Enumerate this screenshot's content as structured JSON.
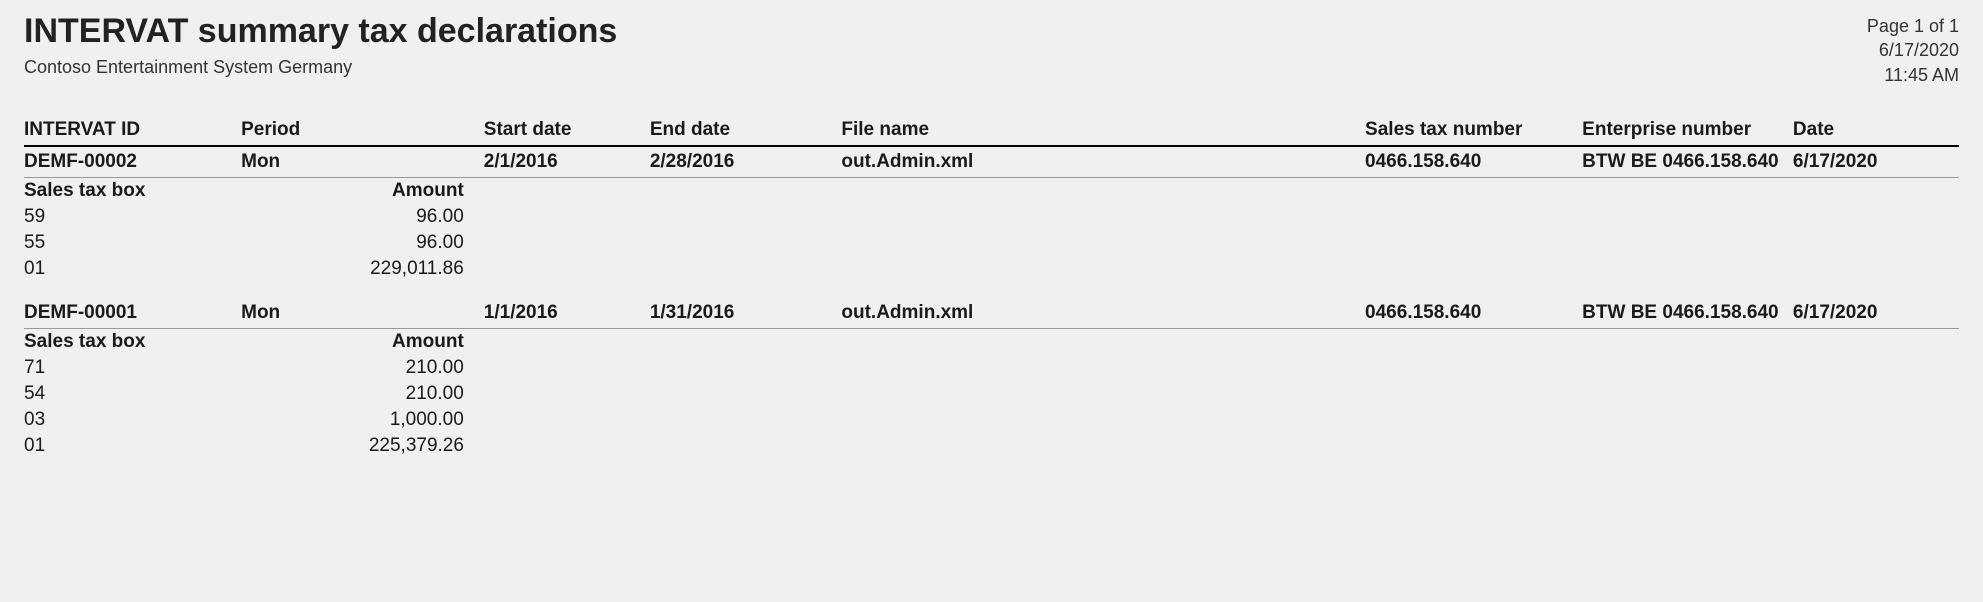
{
  "header": {
    "title": "INTERVAT summary tax declarations",
    "company": "Contoso Entertainment System Germany",
    "page_info": "Page 1 of 1",
    "print_date": "6/17/2020",
    "print_time": "11:45 AM"
  },
  "columns": {
    "intervat_id": "INTERVAT ID",
    "period": "Period",
    "start_date": "Start date",
    "end_date": "End date",
    "file_name": "File name",
    "sales_tax_number": "Sales tax number",
    "enterprise_number": "Enterprise number",
    "date": "Date"
  },
  "sub_columns": {
    "sales_tax_box": "Sales tax box",
    "amount": "Amount"
  },
  "records": [
    {
      "intervat_id": "DEMF-00002",
      "period": "Mon",
      "start_date": "2/1/2016",
      "end_date": "2/28/2016",
      "file_name": "out.Admin.xml",
      "sales_tax_number": "0466.158.640",
      "enterprise_number": "BTW BE 0466.158.640",
      "date": "6/17/2020",
      "lines": [
        {
          "box": "59",
          "amount": "96.00"
        },
        {
          "box": "55",
          "amount": "96.00"
        },
        {
          "box": "01",
          "amount": "229,011.86"
        }
      ]
    },
    {
      "intervat_id": "DEMF-00001",
      "period": "Mon",
      "start_date": "1/1/2016",
      "end_date": "1/31/2016",
      "file_name": "out.Admin.xml",
      "sales_tax_number": "0466.158.640",
      "enterprise_number": "BTW BE 0466.158.640",
      "date": "6/17/2020",
      "lines": [
        {
          "box": "71",
          "amount": "210.00"
        },
        {
          "box": "54",
          "amount": "210.00"
        },
        {
          "box": "03",
          "amount": "1,000.00"
        },
        {
          "box": "01",
          "amount": "225,379.26"
        }
      ]
    }
  ]
}
